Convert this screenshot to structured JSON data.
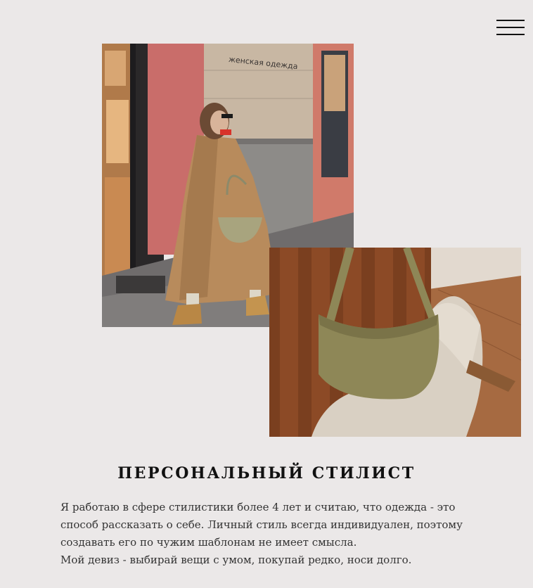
{
  "header": {
    "menu_icon": "hamburger-menu-icon"
  },
  "gallery": {
    "street_photo": {
      "sign_text": "женская одежда"
    },
    "bag_photo": {}
  },
  "about": {
    "title": "ПЕРСОНАЛЬНЫЙ СТИЛИСТ",
    "paragraph_1": "Я работаю в сфере стилистики более 4 лет и считаю, что одежда - это способ рассказать о себе. Личный стиль всегда индивидуален, поэтому создавать его по чужим шаблонам не имеет смысла.",
    "paragraph_2": "Мой девиз - выбирай вещи с умом, покупай редко, носи долго."
  },
  "colors": {
    "background": "#ebe8e8",
    "text_dark": "#111111",
    "text_body": "#333333"
  }
}
